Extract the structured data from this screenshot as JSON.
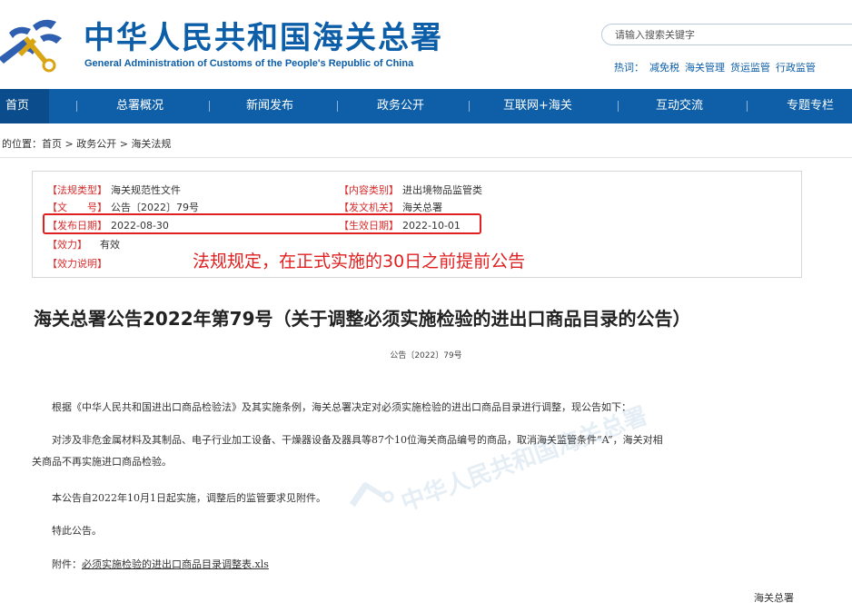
{
  "header": {
    "title": "中华人民共和国海关总署",
    "subtitle": "General Administration of Customs of the People's Republic of China",
    "search_placeholder": "请输入搜索关键字",
    "hot_label": "热词：",
    "hot_words": [
      "减免税",
      "海关管理",
      "货运监管",
      "行政监管"
    ]
  },
  "nav": {
    "items": [
      "首页",
      "总署概况",
      "新闻发布",
      "政务公开",
      "互联网+海关",
      "互动交流",
      "专题专栏"
    ],
    "active_index": 0,
    "separator": "|"
  },
  "breadcrumb": {
    "prefix": "的位置：",
    "items": [
      "首页",
      "政务公开",
      "海关法规"
    ],
    "separator": " > "
  },
  "meta": {
    "regulation_type_label": "【法规类型】",
    "regulation_type": "海关规范性文件",
    "content_category_label": "【内容类别】",
    "content_category": "进出境物品监管类",
    "doc_no_label": "【文　　号】",
    "doc_no": "公告〔2022〕79号",
    "issuer_label": "【发文机关】",
    "issuer": "海关总署",
    "publish_date_label": "【发布日期】",
    "publish_date": "2022-08-30",
    "effective_date_label": "【生效日期】",
    "effective_date": "2022-10-01",
    "validity_label": "【效力】",
    "validity": "有效",
    "validity_note_label": "【效力说明】",
    "validity_note": ""
  },
  "annotation": "法规规定，在正式实施的30日之前提前公告",
  "article": {
    "title": "海关总署公告2022年第79号（关于调整必须实施检验的进出口商品目录的公告）",
    "doc_number": "公告〔2022〕79号",
    "para1": "根据《中华人民共和国进出口商品检验法》及其实施条例，海关总署决定对必须实施检验的进出口商品目录进行调整，现公告如下：",
    "para2_line1": "对涉及非危金属材料及其制品、电子行业加工设备、干燥器设备及器具等87个10位海关商品编号的商品，取消海关监管条件“A”，海关对相",
    "para2_line2": "关商品不再实施进口商品检验。",
    "para3": "本公告自2022年10月1日起实施，调整后的监管要求见附件。",
    "para4": "特此公告。",
    "attachment_label": "附件：",
    "attachment_link": "必须实施检验的进出口商品目录调整表.xls",
    "signature": "海关总署"
  },
  "colors": {
    "brand_blue": "#0e5fa8",
    "nav_active": "#0a4c8c",
    "label_red": "#d62b2b",
    "annotation_red": "#e02020"
  }
}
